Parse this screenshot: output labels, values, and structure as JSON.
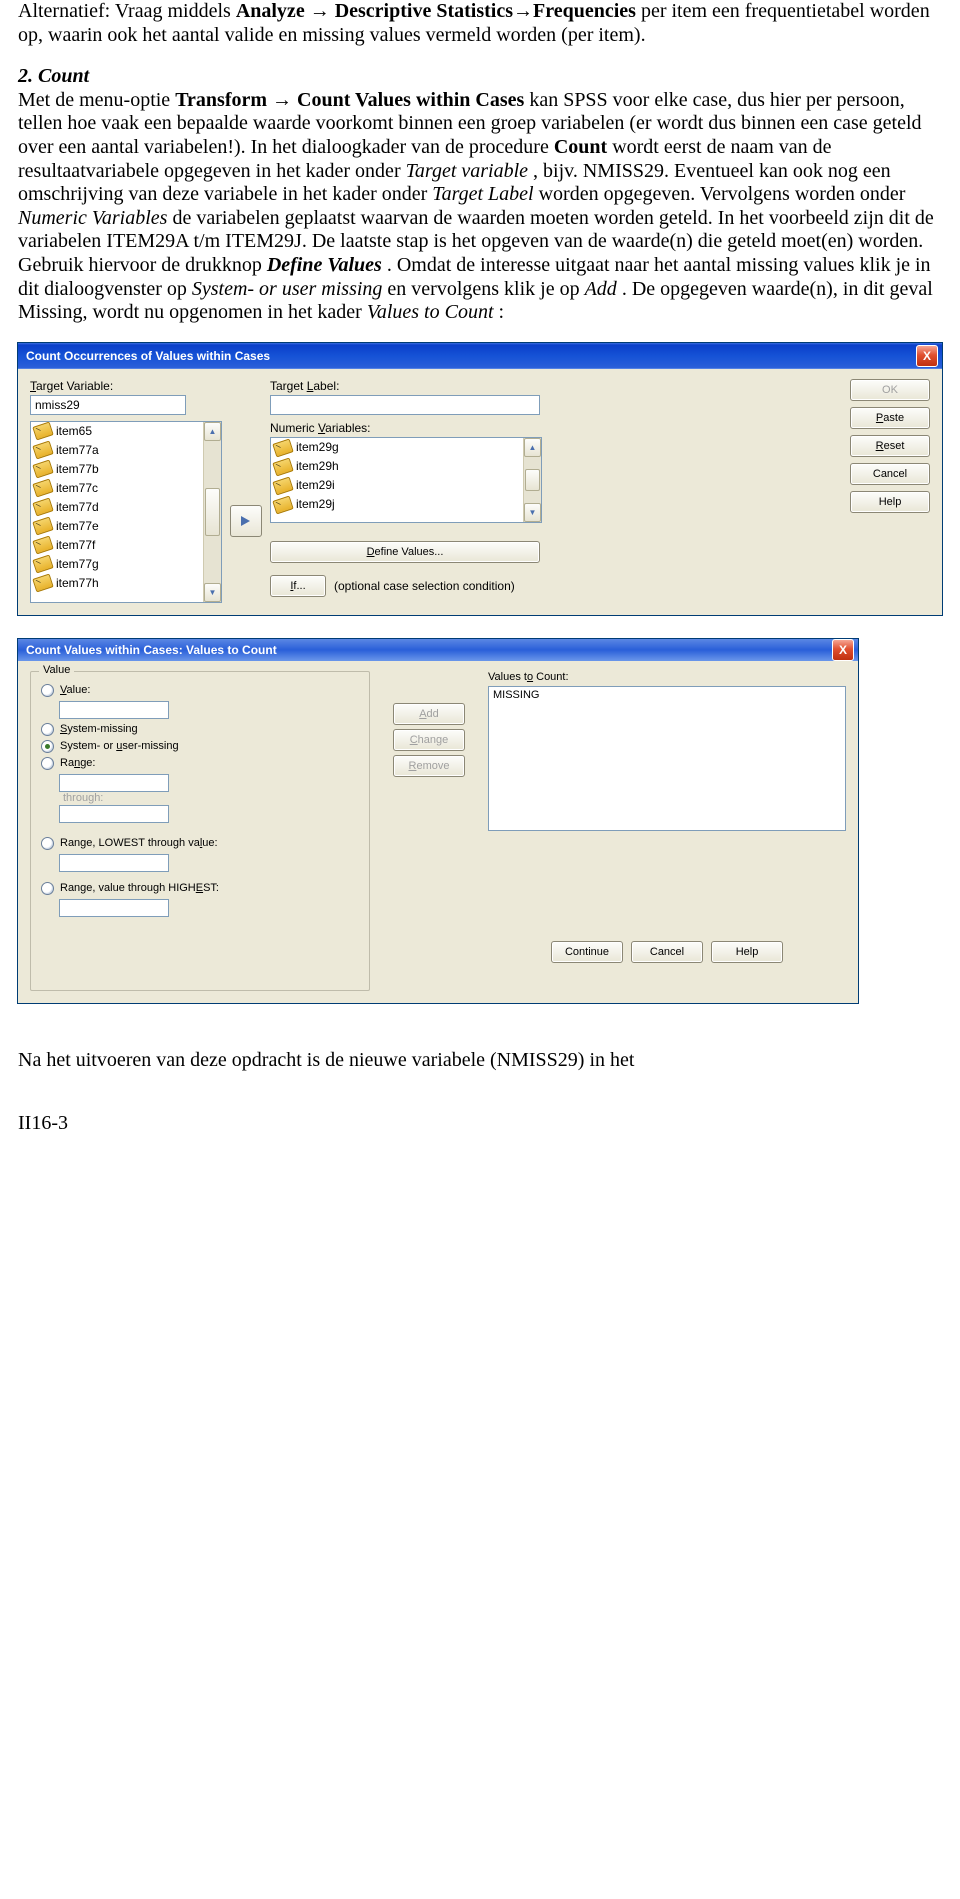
{
  "para1": {
    "pre": "Alternatief: Vraag middels ",
    "menupath": "Analyze → Descriptive Statistics→Frequencies",
    "post": " per item een frequentietabel worden op, waarin ook het aantal valide en missing values vermeld worden (per item)."
  },
  "para2": {
    "heading": "2. Count",
    "t1": "Met de menu-optie ",
    "m1": "Transform → Count Values within Cases",
    "t2": " kan SPSS voor elke case, dus hier per persoon, tellen hoe vaak een bepaalde waarde voorkomt binnen een groep variabelen (er wordt dus binnen een case geteld over een aantal variabelen!). In het dialoogkader van de procedure ",
    "m2": "Count",
    "t3": " wordt eerst de naam van de resultaatvariabele opgegeven in het kader onder ",
    "i1": "Target variable",
    "t4": ", bijv. NMISS29. Eventueel kan ook nog een omschrijving van deze variabele in het kader onder ",
    "i2": "Target Label",
    "t5": " worden opgegeven. Vervolgens worden onder ",
    "i3": "Numeric Variables",
    "t6": " de variabelen geplaatst waarvan de waarden moeten worden geteld. In het voorbeeld zijn dit de variabelen ITEM29A t/m ITEM29J. De laatste stap is het opgeven van de waarde(n) die geteld moet(en) worden. Gebruik hiervoor de drukknop ",
    "bi1": "Define Values",
    "t7": ". Omdat de interesse uitgaat naar het aantal missing values klik je in dit dialoogvenster op ",
    "i4": "System- or user missing",
    "t8": " en vervolgens klik je op ",
    "i5": "Add",
    "t9": ". De opgegeven waarde(n), in dit geval Missing, wordt nu opgenomen in het kader ",
    "i6": "Values to Count",
    "t10": ":"
  },
  "dialog1": {
    "title": "Count Occurrences of Values within Cases",
    "close_x": "X",
    "target_var_lbl": "Target Variable:",
    "target_var_val": "nmiss29",
    "target_lbl_lbl": "Target Label:",
    "target_lbl_val": "",
    "numeric_lbl": "Numeric Variables:",
    "left_list": [
      "item65",
      "item77a",
      "item77b",
      "item77c",
      "item77d",
      "item77e",
      "item77f",
      "item77g",
      "item77h"
    ],
    "right_list": [
      "item29g",
      "item29h",
      "item29i",
      "item29j"
    ],
    "btn_define": "Define Values...",
    "btn_if": "If...",
    "if_note": "(optional case selection condition)",
    "buttons": {
      "ok": "OK",
      "paste": "Paste",
      "reset": "Reset",
      "cancel": "Cancel",
      "help": "Help"
    }
  },
  "dialog2": {
    "title": "Count Values within Cases: Values to Count",
    "close_x": "X",
    "grp_value": "Value",
    "r_value": "Value:",
    "r_sysmiss": "System-missing",
    "r_sysuser": "System- or user-missing",
    "r_range": "Range:",
    "through": "through:",
    "r_lowest": "Range, LOWEST through value:",
    "r_highest": "Range, value through HIGHEST:",
    "btn_add": "Add",
    "btn_change": "Change",
    "btn_remove": "Remove",
    "vtc_lbl": "Values to Count:",
    "vtc_list": [
      "MISSING"
    ],
    "btn_continue": "Continue",
    "btn_cancel": "Cancel",
    "btn_help": "Help"
  },
  "footer": "Na het uitvoeren van deze opdracht is de nieuwe variabele (NMISS29) in het",
  "page": "II16-3"
}
